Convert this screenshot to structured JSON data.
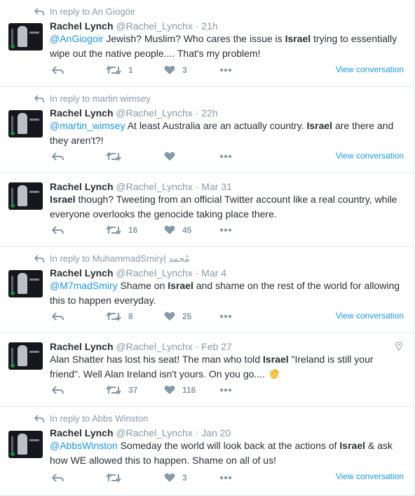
{
  "tweets": [
    {
      "reply_context": "In reply to An Gíogóir",
      "name": "Rachel Lynch",
      "handle": "@Rachel_Lynchx",
      "sep": "·",
      "time": "21h",
      "mention": "@AnGiogoir",
      "text_a": " Jewish? Muslim? Who cares the issue is ",
      "bold": "Israel",
      "text_b": " trying to essentially wipe out the native people.... That's my problem!",
      "retweets": "1",
      "likes": "3",
      "view_label": "View conversation"
    },
    {
      "reply_context": "In reply to martin wimsey",
      "name": "Rachel Lynch",
      "handle": "@Rachel_Lynchx",
      "sep": "·",
      "time": "22h",
      "mention": "@martin_wimsey",
      "text_a": " At least Australia are an actually country. ",
      "bold": "Israel",
      "text_b": " are there and they aren't?!",
      "retweets": "",
      "likes": "",
      "view_label": "View conversation"
    },
    {
      "reply_context": "",
      "name": "Rachel Lynch",
      "handle": "@Rachel_Lynchx",
      "sep": "·",
      "time": "Mar 31",
      "mention": "",
      "text_a": "",
      "bold": "Israel",
      "text_b": " though? Tweeting from an official Twitter account like a real country, while everyone overlooks the genocide taking place there.",
      "retweets": "16",
      "likes": "45",
      "view_label": ""
    },
    {
      "reply_context": "In reply to MuhammadSmiry| مُحمد",
      "name": "Rachel Lynch",
      "handle": "@Rachel_Lynchx",
      "sep": "·",
      "time": "Mar 4",
      "mention": "@M7madSmiry",
      "text_a": " Shame on ",
      "bold": "Israel",
      "text_b": " and shame on the rest of the world for allowing this to happen everyday.",
      "retweets": "8",
      "likes": "25",
      "view_label": "View conversation"
    },
    {
      "reply_context": "",
      "name": "Rachel Lynch",
      "handle": "@Rachel_Lynchx",
      "sep": "·",
      "time": "Feb 27",
      "mention": "",
      "text_a": "Alan Shatter has lost his seat! The man who told ",
      "bold": "Israel",
      "text_b": " \"Ireland is still your friend\". Well Alan Ireland isn't yours. On you go....",
      "retweets": "37",
      "likes": "116",
      "view_label": ""
    },
    {
      "reply_context": "In reply to Abbs Winston",
      "name": "Rachel Lynch",
      "handle": "@Rachel_Lynchx",
      "sep": "·",
      "time": "Jan 20",
      "mention": "@AbbsWinston",
      "text_a": " Someday the world will look back at the actions of ",
      "bold": "Israel",
      "text_b": " & ask how WE allowed this to happen. Shame on all of us!",
      "retweets": "",
      "likes": "3",
      "view_label": "View conversation"
    }
  ],
  "icons": {
    "reply": "reply-icon",
    "retweet": "retweet-icon",
    "like": "heart-icon",
    "more": "more-icon",
    "location": "location-pin-icon",
    "emoji": "waving-hand-emoji"
  },
  "colors": {
    "link": "#1b95e0",
    "muted": "#8899a6",
    "text": "#292f33",
    "divider": "#e1e8ed"
  }
}
